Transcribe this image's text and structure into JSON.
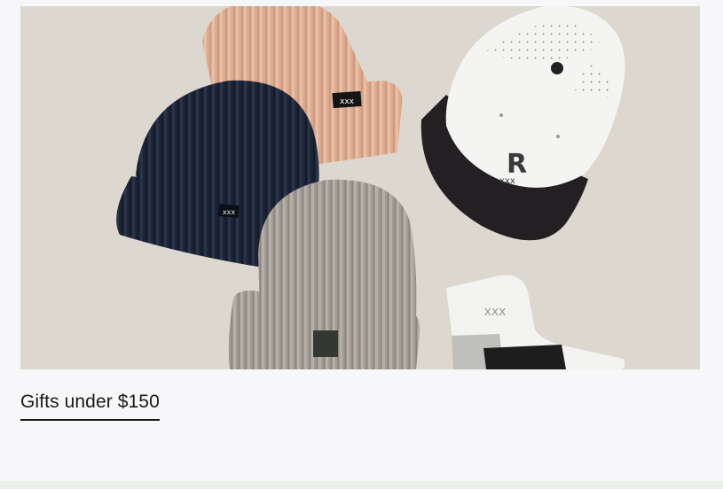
{
  "hero": {
    "alt": "Assorted knit beanies, white performance cap and socks",
    "cap_letter": "R"
  },
  "promo": {
    "link_label": "Gifts under $150"
  },
  "colors": {
    "page_background": "#f7f6f8",
    "image_background": "#dcd8cf",
    "text": "#1a1a1a"
  }
}
